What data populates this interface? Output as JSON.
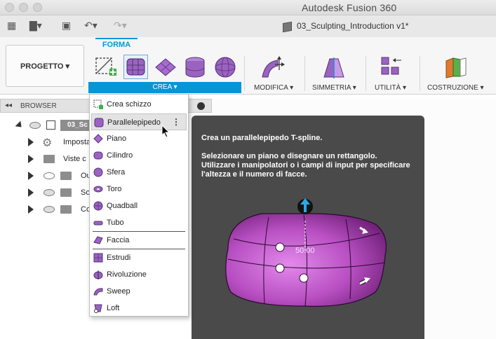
{
  "window": {
    "title": "Autodesk Fusion 360"
  },
  "document": {
    "title": "03_Sculpting_Introduction v1*"
  },
  "ribbon": {
    "active_tab": "FORMA",
    "project_button": "PROGETTO ▾",
    "crea_label": "CREA ▾",
    "groups": [
      {
        "label": "MODIFICA ▾"
      },
      {
        "label": "SIMMETRIA ▾"
      },
      {
        "label": "UTILITÀ ▾"
      },
      {
        "label": "COSTRUZIONE ▾"
      }
    ]
  },
  "browser": {
    "header": "BROWSER",
    "root": "03_Sc",
    "items": [
      {
        "label": "Imposta"
      },
      {
        "label": "Viste c"
      },
      {
        "label": "Ou"
      },
      {
        "label": "So"
      },
      {
        "label": "Co"
      }
    ]
  },
  "menu": {
    "items": [
      {
        "label": "Crea schizzo",
        "icon": "sketch-icon"
      },
      {
        "label": "Parallelepipedo",
        "icon": "box-icon"
      },
      {
        "label": "Piano",
        "icon": "plane-icon"
      },
      {
        "label": "Cilindro",
        "icon": "cylinder-icon"
      },
      {
        "label": "Sfera",
        "icon": "sphere-icon"
      },
      {
        "label": "Toro",
        "icon": "torus-icon"
      },
      {
        "label": "Quadball",
        "icon": "quadball-icon"
      },
      {
        "label": "Tubo",
        "icon": "pipe-icon"
      },
      {
        "label": "Faccia",
        "icon": "face-icon"
      },
      {
        "label": "Estrudi",
        "icon": "extrude-icon"
      },
      {
        "label": "Rivoluzione",
        "icon": "revolve-icon"
      },
      {
        "label": "Sweep",
        "icon": "sweep-icon"
      },
      {
        "label": "Loft",
        "icon": "loft-icon"
      }
    ],
    "kebab": "⋮"
  },
  "tooltip": {
    "title": "Crea un parallelepipedo T-spline.",
    "body": "Selezionare un piano e disegnare un rettangolo. Utilizzare i manipolatori o i campi di input per specificare l'altezza e il numero di facce.",
    "dimension": "50.00"
  },
  "colors": {
    "accent": "#0696d7",
    "tooltip_bg": "#4a4a4a",
    "tspline": "#b84fc2"
  }
}
